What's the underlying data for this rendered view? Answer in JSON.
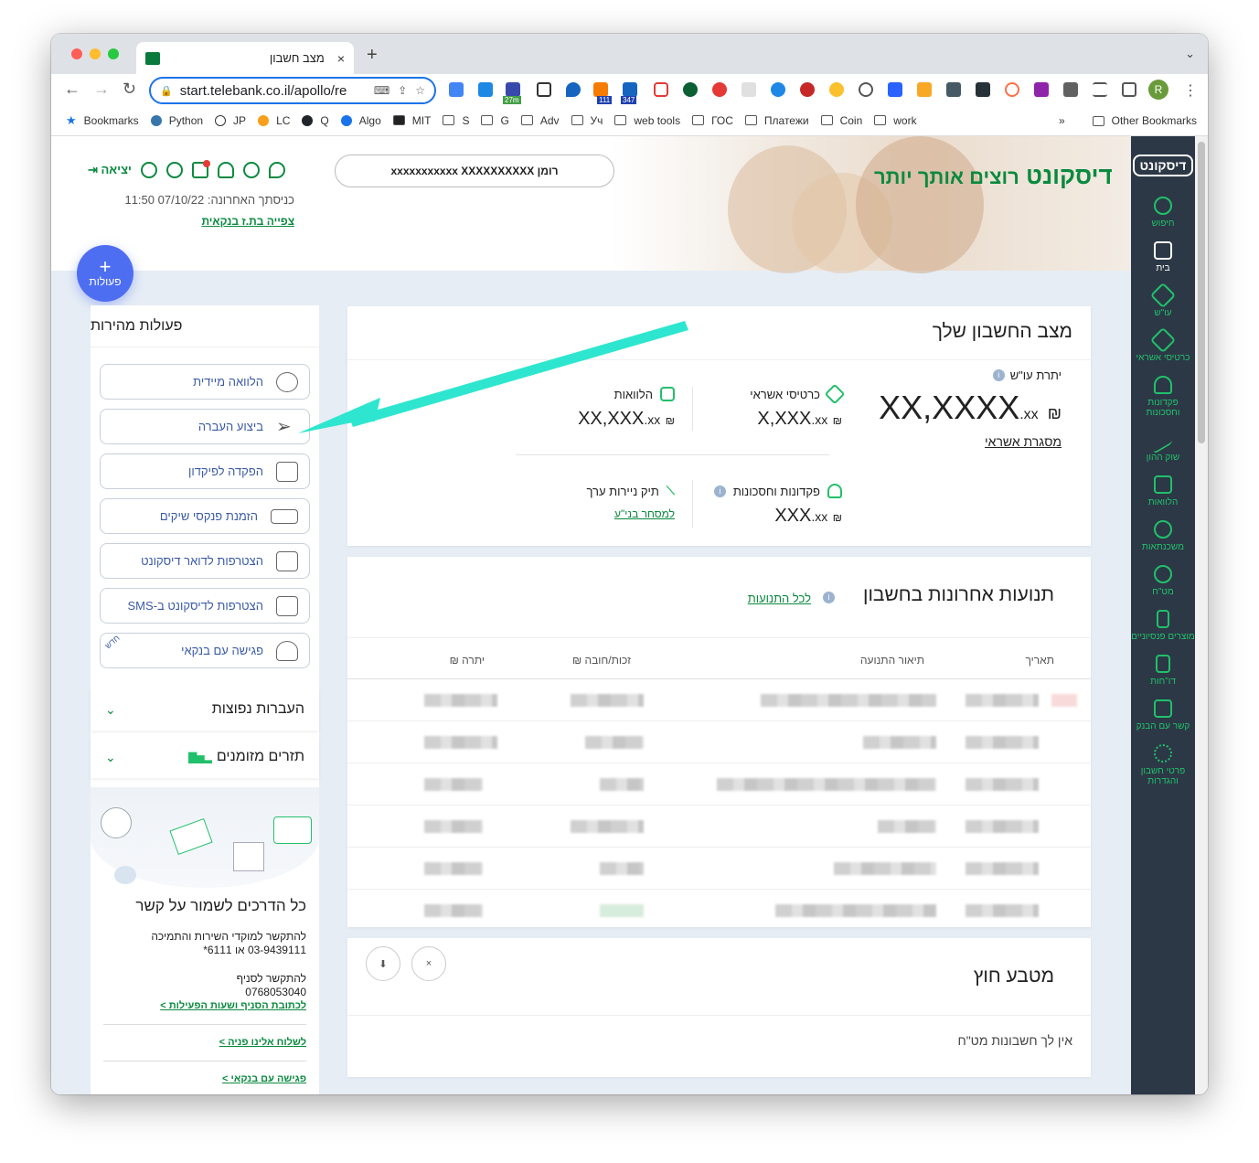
{
  "browser": {
    "tab_title": "מצב חשבון",
    "tab_close": "×",
    "new_tab": "+",
    "url": "start.telebank.co.il/apollo/re",
    "avatar_letter": "R",
    "badge_1": "27m",
    "badge_2": "111",
    "badge_3": "347",
    "bookmarks": [
      {
        "label": "Bookmarks",
        "icon": "star-icon"
      },
      {
        "label": "Python",
        "icon": "python-icon"
      },
      {
        "label": "JP",
        "icon": "jp-icon"
      },
      {
        "label": "LC",
        "icon": "lc-icon"
      },
      {
        "label": "Q",
        "icon": "q-icon"
      },
      {
        "label": "Algo",
        "icon": "algo-icon"
      },
      {
        "label": "MIT",
        "icon": "mit-icon"
      },
      {
        "label": "S",
        "icon": "folder-icon"
      },
      {
        "label": "G",
        "icon": "folder-icon"
      },
      {
        "label": "Adv",
        "icon": "folder-icon"
      },
      {
        "label": "Уч",
        "icon": "folder-icon"
      },
      {
        "label": "web tools",
        "icon": "folder-icon"
      },
      {
        "label": "ГОС",
        "icon": "folder-icon"
      },
      {
        "label": "Платежи",
        "icon": "folder-icon"
      },
      {
        "label": "Coin",
        "icon": "folder-icon"
      },
      {
        "label": "work",
        "icon": "folder-icon"
      }
    ],
    "more": "»",
    "other_bookmarks": "Other Bookmarks"
  },
  "header": {
    "logo_brand": "דיסקונט",
    "logo_slogan": "רוצים אותך יותר",
    "account_selector": "רומן xxxxxxxxxxx XXXXXXXXXX",
    "logout": "יציאה",
    "last_login": "כניסתך האחרונה: 07/10/22 11:50",
    "view_bank": "צפייה בת.ז בנקאית",
    "fab_label": "פעולות",
    "fab_plus": "+"
  },
  "sidebar_nav": {
    "logo": "דיסקונט",
    "items": [
      {
        "label": "חיפוש",
        "icon": "search-icon"
      },
      {
        "label": "בית",
        "icon": "home-icon"
      },
      {
        "label": "עו\"ש",
        "icon": "checking-icon"
      },
      {
        "label": "כרטיסי אשראי",
        "icon": "credit-card-icon"
      },
      {
        "label": "פקדונות וחסכונות",
        "icon": "plant-icon"
      },
      {
        "label": "שוק ההון",
        "icon": "trend-icon"
      },
      {
        "label": "הלוואות",
        "icon": "loan-icon"
      },
      {
        "label": "משכנתאות",
        "icon": "clock-icon"
      },
      {
        "label": "מט\"ח",
        "icon": "dollar-icon"
      },
      {
        "label": "מוצרים פנסיוניים",
        "icon": "pension-icon"
      },
      {
        "label": "דו\"חות",
        "icon": "report-icon"
      },
      {
        "label": "קשר עם הבנק",
        "icon": "contact-icon"
      },
      {
        "label": "פרטי חשבון והגדרות",
        "icon": "settings-icon"
      }
    ]
  },
  "quick_actions": {
    "title": "פעולות מהירות",
    "items": [
      {
        "label": "הלוואה מיידית",
        "icon": "coins-icon"
      },
      {
        "label": "ביצוע העברה",
        "icon": "send-icon"
      },
      {
        "label": "הפקדה לפיקדון",
        "icon": "deposit-icon"
      },
      {
        "label": "הזמנת פנקסי שיקים",
        "icon": "checkbook-icon"
      },
      {
        "label": "הצטרפות לדואר דיסקונט",
        "icon": "mail-plus-icon"
      },
      {
        "label": "הצטרפות לדיסקונט ב-SMS",
        "icon": "sms-plus-icon"
      },
      {
        "label": "פגישה עם בנקאי",
        "icon": "banker-icon",
        "tag": "חדש"
      }
    ],
    "common_transfers": "העברות נפוצות",
    "smart_charts": "תזרים מזומנים"
  },
  "contact": {
    "title": "כל הדרכים לשמור על קשר",
    "service_line1": "להתקשר למוקדי השירות והתמיכה",
    "service_line2": "03-9439111 או 6111*",
    "branch_line1": "להתקשר לסניף",
    "branch_phone": "0768053040",
    "branch_link": "לכתובת הסניף ושעות הפעילות >",
    "message_link": "לשלוח אלינו פניה >",
    "meeting_link": "פגישה עם בנקאי >"
  },
  "account_status": {
    "title": "מצב החשבון שלך",
    "balance_label": "יתרת עו\"ש",
    "balance_value": "XX,XXXX",
    "balance_cents": ".xx",
    "currency": "₪",
    "credit_line": "מסגרת אשראי",
    "cards_label": "כרטיסי אשראי",
    "cards_value": "X,XXX",
    "cards_cents": ".xx",
    "loans_label": "הלוואות",
    "loans_value": "XX,XXX",
    "loans_cents": ".xx",
    "deposits_label": "פקדונות וחסכונות",
    "deposits_value": "XXX",
    "deposits_cents": ".xx",
    "securities_label": "תיק ניירות ערך",
    "securities_link": "למסחר בני\"ע"
  },
  "transactions": {
    "title": "תנועות אחרונות בחשבון",
    "all_link": "לכל התנועות",
    "columns": [
      "תאריך",
      "תיאור התנועה",
      "זכות/חובה ₪",
      "יתרה ₪"
    ]
  },
  "fx": {
    "title": "מטבע חוץ",
    "note": "אין לך חשבונות מט\"ח",
    "download": "⬇",
    "close": "×"
  },
  "colors": {
    "brand_green": "#0a8a3f",
    "accent_green": "#21c06a",
    "nav_bg": "#2c3846",
    "fab_blue": "#4e6ef2",
    "annotation_arrow": "#2ee6cf"
  }
}
